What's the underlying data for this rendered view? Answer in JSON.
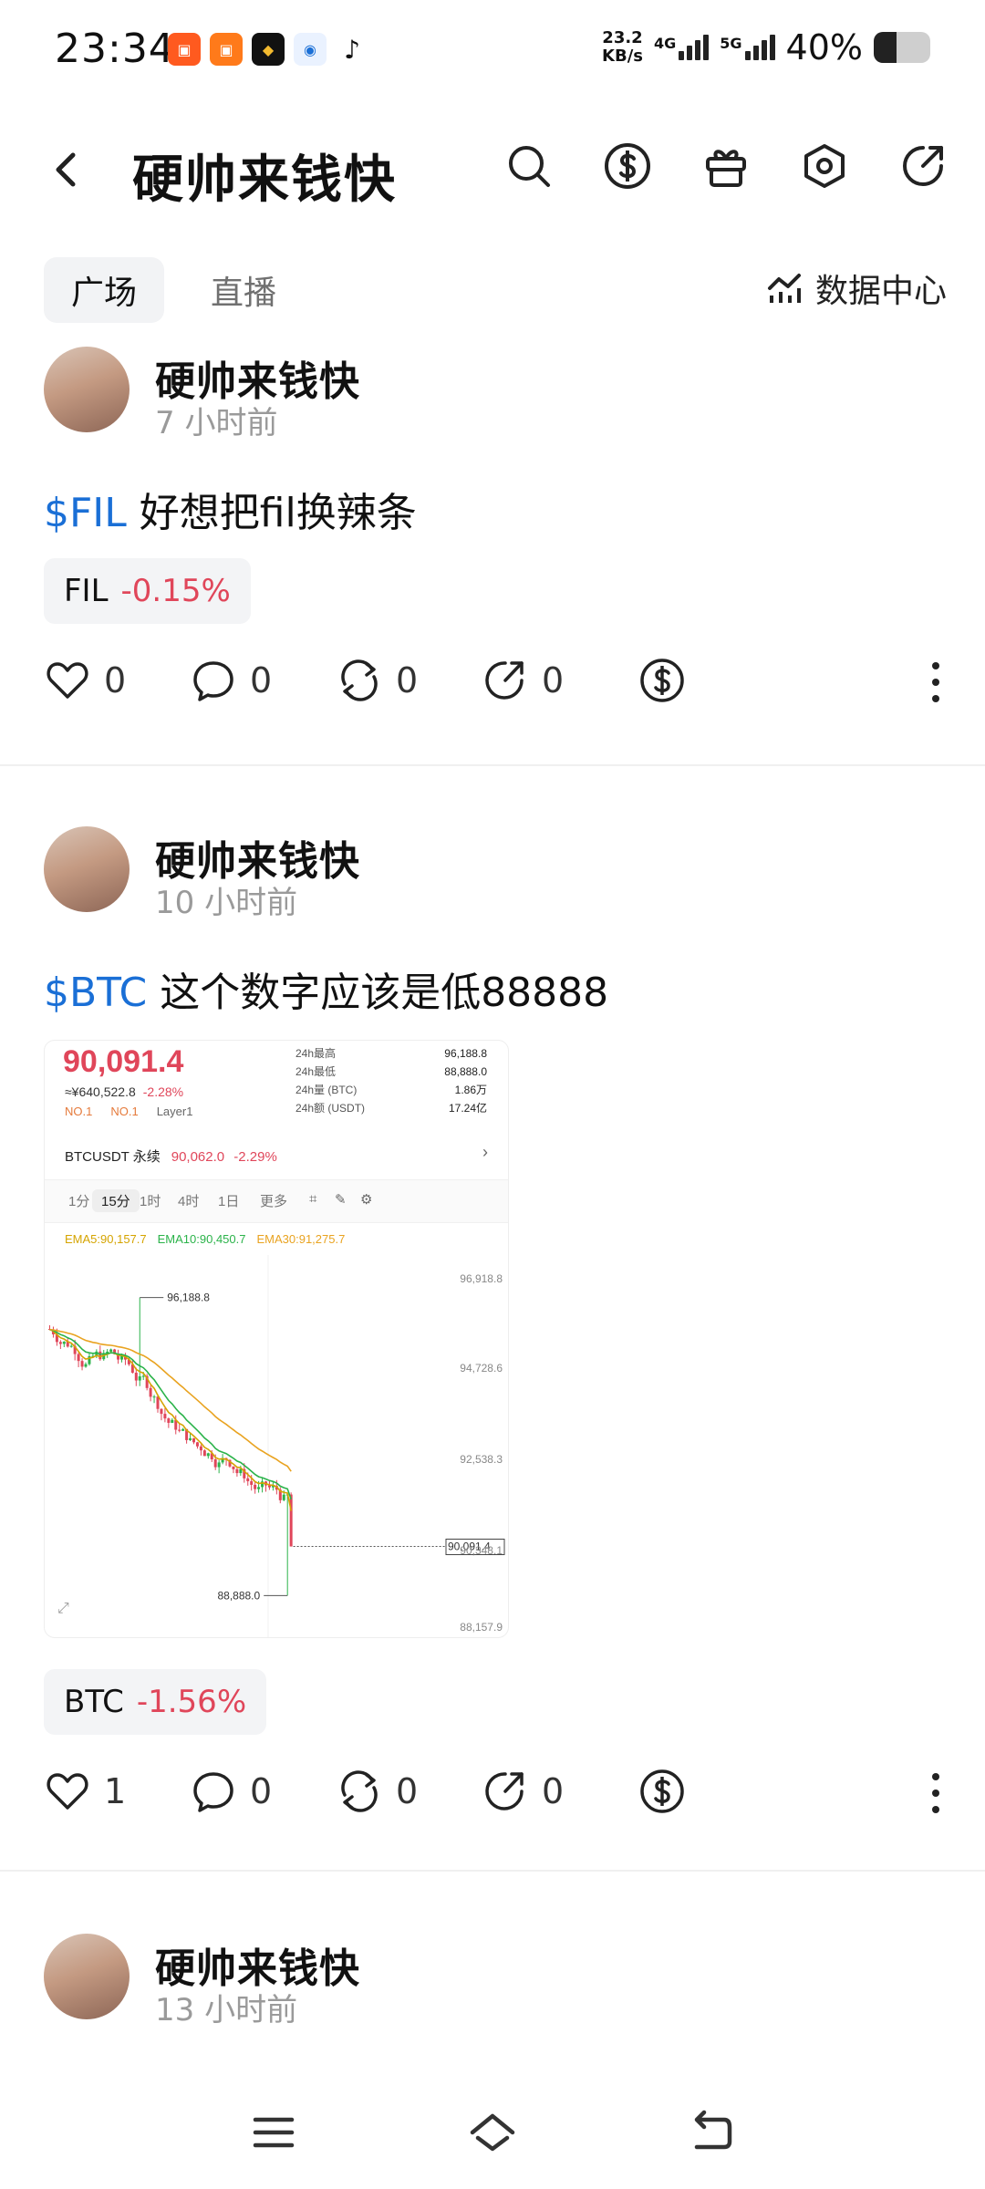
{
  "status_bar": {
    "time": "23:34",
    "net_speed_value": "23.2",
    "net_speed_unit": "KB/s",
    "sim1": "4G",
    "sim2": "5G",
    "battery": "40%",
    "battery_level": 0.4
  },
  "header": {
    "title": "硬帅来钱快"
  },
  "tabs": {
    "active": "广场",
    "inactive": "直播",
    "data_center": "数据中心"
  },
  "posts": [
    {
      "author": "硬帅来钱快",
      "time": "7 小时前",
      "ticker": "$FIL",
      "text": " 好想把fil换辣条",
      "coin": "FIL",
      "change": "-0.15%",
      "likes": "0",
      "comments": "0",
      "reposts": "0",
      "shares": "0"
    },
    {
      "author": "硬帅来钱快",
      "time": "10 小时前",
      "ticker": "$BTC",
      "text": " 这个数字应该是低88888",
      "coin": "BTC",
      "change": "-1.56%",
      "likes": "1",
      "comments": "0",
      "reposts": "0",
      "shares": "0"
    },
    {
      "author": "硬帅来钱快",
      "time": "13 小时前"
    }
  ],
  "chart_image": {
    "price": "90,091.4",
    "cny": "≈¥640,522.8",
    "pct": "-2.28%",
    "badge1": "NO.1",
    "badge2": "NO.1",
    "badge3": "Layer1",
    "stats": [
      {
        "label": "24h最高",
        "value": "96,188.8"
      },
      {
        "label": "24h最低",
        "value": "88,888.0"
      },
      {
        "label": "24h量 (BTC)",
        "value": "1.86万"
      },
      {
        "label": "24h额 (USDT)",
        "value": "17.24亿"
      }
    ],
    "perp_label": "BTCUSDT 永续",
    "perp_price": "90,062.0",
    "perp_pct": "-2.29%",
    "timeframes": [
      "1分",
      "15分",
      "1时",
      "4时",
      "1日",
      "更多"
    ],
    "ema5": "EMA5:90,157.7",
    "ema10": "EMA10:90,450.7",
    "ema30": "EMA30:91,275.7",
    "y_ticks": [
      "96,918.8",
      "94,728.6",
      "92,538.3",
      "90,348.1",
      "88,157.9"
    ],
    "high_label": "96,188.8",
    "low_label": "88,888.0",
    "last_label": "90,091.4"
  },
  "colors": {
    "up": "#2bb34a",
    "down": "#e0465a",
    "ticker": "#1a6fd6"
  }
}
